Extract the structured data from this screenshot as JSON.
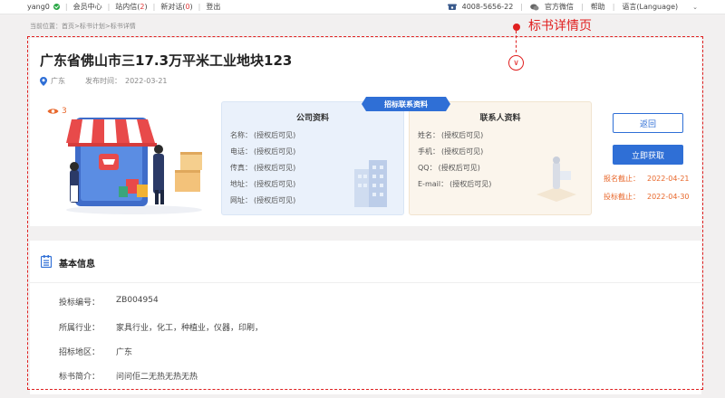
{
  "topbar": {
    "username": "yang0",
    "member_center": "会员中心",
    "inbox_label": "站内信(",
    "inbox_count": "2",
    "inbox_close": ")",
    "subs_label": "新对话(",
    "subs_count": "0",
    "subs_close": ")",
    "logout": "登出",
    "phone": "4008-5656-22",
    "wechat": "官方微信",
    "help": "帮助",
    "language": "语言(Language)"
  },
  "breadcrumb": "当前位置：首页>标书计划>标书详情",
  "annotation": {
    "label": "标书详情页"
  },
  "detail": {
    "title": "广东省佛山市三17.3万平米工业地块123",
    "location": "广东",
    "publish_label": "发布时间：",
    "publish_date": "2022-03-21",
    "views": "3"
  },
  "ribbon": "招标联系资料",
  "company": {
    "title": "公司资料",
    "rows": [
      {
        "k": "名称：",
        "v": "(授权后可见)"
      },
      {
        "k": "电话：",
        "v": "(授权后可见)"
      },
      {
        "k": "传真：",
        "v": "(授权后可见)"
      },
      {
        "k": "地址：",
        "v": "(授权后可见)"
      },
      {
        "k": "网址：",
        "v": "(授权后可见)"
      }
    ]
  },
  "contact": {
    "title": "联系人资料",
    "rows": [
      {
        "k": "姓名：",
        "v": "(授权后可见)"
      },
      {
        "k": "手机：",
        "v": "(授权后可见)"
      },
      {
        "k": "QQ：",
        "v": "(授权后可见)"
      },
      {
        "k": "E-mail：",
        "v": "(授权后可见)"
      }
    ]
  },
  "actions": {
    "back": "返回",
    "get_now": "立即获取",
    "signup_deadline_label": "报名截止：",
    "signup_deadline": "2022-04-21",
    "bid_deadline_label": "投标截止：",
    "bid_deadline": "2022-04-30"
  },
  "basic_info": {
    "title": "基本信息",
    "rows": [
      {
        "k": "投标编号：",
        "v": "ZB004954"
      },
      {
        "k": "所属行业：",
        "v": "家具行业，化工，种植业，仪器，印刷，"
      },
      {
        "k": "招标地区：",
        "v": "广东"
      },
      {
        "k": "标书简介：",
        "v": "问问佢二无热无热无热"
      }
    ]
  },
  "colors": {
    "accent": "#2f6fd6",
    "orange": "#e8682c",
    "annotation": "#e02020"
  }
}
